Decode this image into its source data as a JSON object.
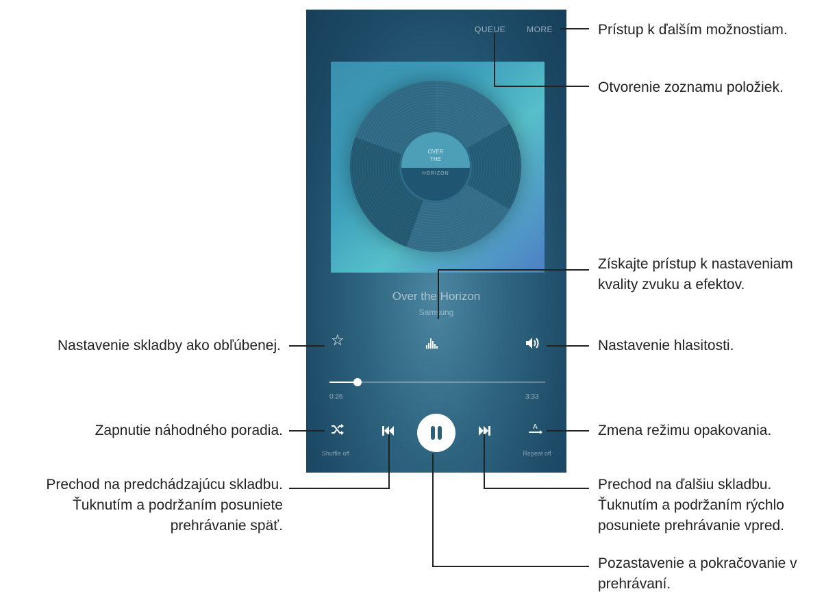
{
  "player": {
    "queue_label": "QUEUE",
    "more_label": "MORE",
    "album_art": {
      "line1": "OVER",
      "line2": "THE",
      "line3": "HORIZON"
    },
    "song_title": "Over the Horizon",
    "artist": "Samsung",
    "progress": {
      "current": "0:26",
      "total": "3:33",
      "fraction": 0.13
    },
    "shuffle_label": "Shuffle off",
    "repeat_label": "Repeat off",
    "icons": [
      "star-icon",
      "sound-effects-icon",
      "volume-icon",
      "shuffle-icon",
      "previous-icon",
      "pause-icon",
      "next-icon",
      "repeat-icon"
    ],
    "colors": {
      "background": "#1d4a66",
      "accent": "#ffffff",
      "pause_glyph": "#2a5f79"
    }
  },
  "annotations": {
    "more": "Prístup k ďalším možnostiam.",
    "queue": "Otvorenie zoznamu položiek.",
    "sound": "Získajte prístup k nastaveniam kvality zvuku a efektov.",
    "favourite": "Nastavenie skladby ako obľúbenej.",
    "volume": "Nastavenie hlasitosti.",
    "shuffle": "Zapnutie náhodného poradia.",
    "repeat": "Zmena režimu opakovania.",
    "previous": "Prechod na predchádzajúcu skladbu. Ťuknutím a podržaním posuniete prehrávanie späť.",
    "next": "Prechod na ďalšiu skladbu. Ťuknutím a podržaním rýchlo posuniete prehrávanie vpred.",
    "pause": "Pozastavenie a pokračovanie v prehrávaní."
  }
}
